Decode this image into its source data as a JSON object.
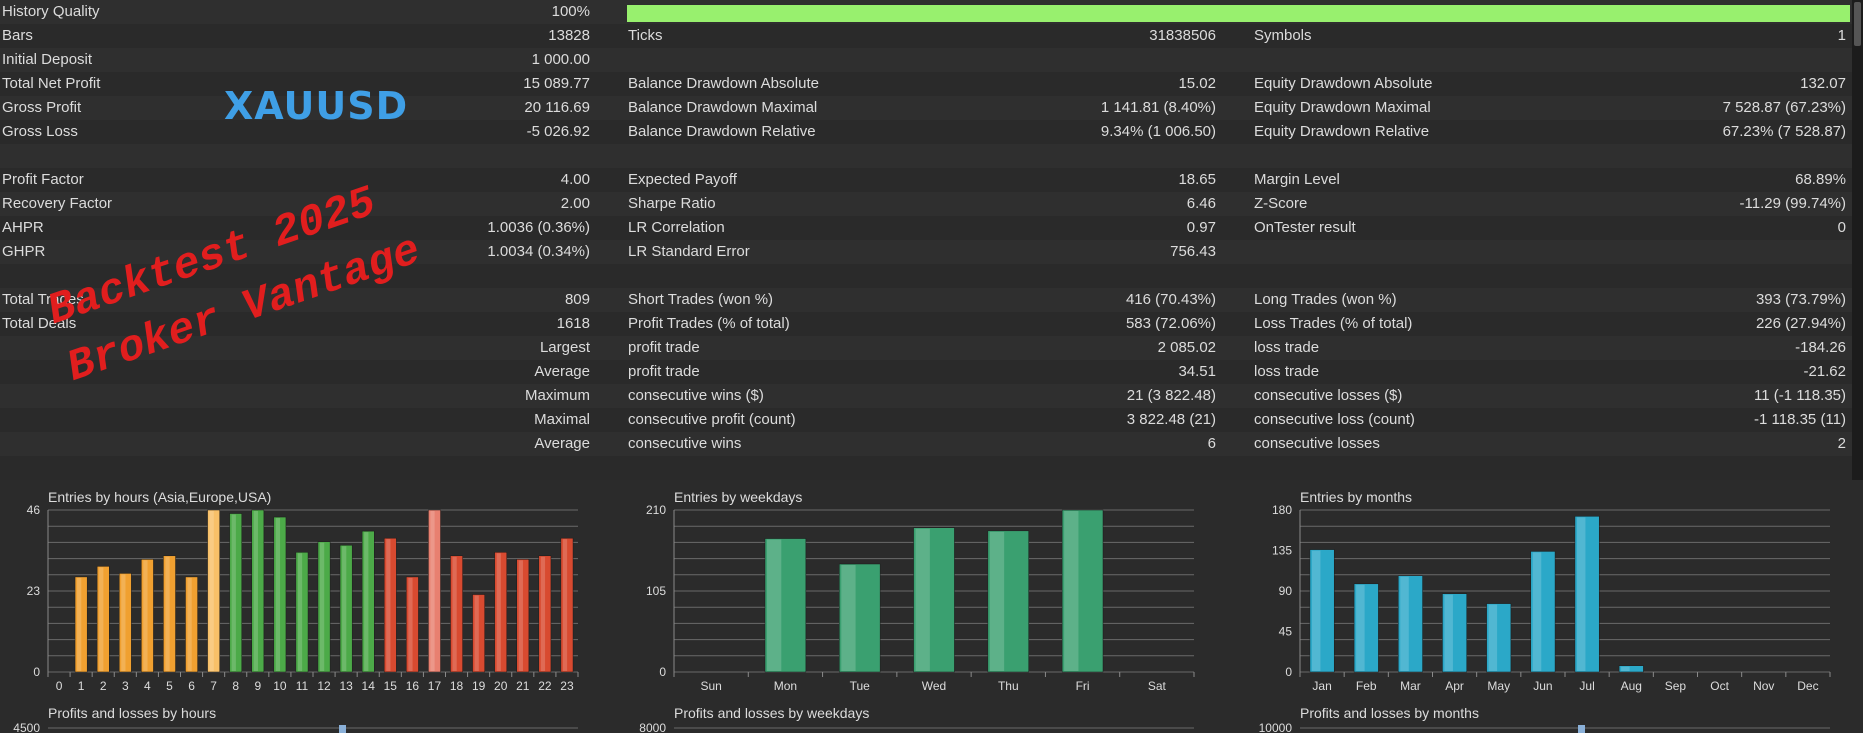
{
  "rows": [
    {
      "l1": "History Quality",
      "v1": "100%",
      "l2": "",
      "v2": "",
      "l3": "",
      "v3": ""
    },
    {
      "l1": "Bars",
      "v1": "13828",
      "l2": "Ticks",
      "v2": "31838506",
      "l3": "Symbols",
      "v3": "1"
    },
    {
      "l1": "Initial Deposit",
      "v1": "1 000.00",
      "l2": "",
      "v2": "",
      "l3": "",
      "v3": ""
    },
    {
      "l1": "Total Net Profit",
      "v1": "15 089.77",
      "l2": "Balance Drawdown Absolute",
      "v2": "15.02",
      "l3": "Equity Drawdown Absolute",
      "v3": "132.07"
    },
    {
      "l1": "Gross Profit",
      "v1": "20 116.69",
      "l2": "Balance Drawdown Maximal",
      "v2": "1 141.81 (8.40%)",
      "l3": "Equity Drawdown Maximal",
      "v3": "7 528.87 (67.23%)"
    },
    {
      "l1": "Gross Loss",
      "v1": "-5 026.92",
      "l2": "Balance Drawdown Relative",
      "v2": "9.34% (1 006.50)",
      "l3": "Equity Drawdown Relative",
      "v3": "67.23% (7 528.87)"
    },
    {
      "l1": "",
      "v1": "",
      "l2": "",
      "v2": "",
      "l3": "",
      "v3": ""
    },
    {
      "l1": "Profit Factor",
      "v1": "4.00",
      "l2": "Expected Payoff",
      "v2": "18.65",
      "l3": "Margin Level",
      "v3": "68.89%"
    },
    {
      "l1": "Recovery Factor",
      "v1": "2.00",
      "l2": "Sharpe Ratio",
      "v2": "6.46",
      "l3": "Z-Score",
      "v3": "-11.29 (99.74%)"
    },
    {
      "l1": "AHPR",
      "v1": "1.0036 (0.36%)",
      "l2": "LR Correlation",
      "v2": "0.97",
      "l3": "OnTester result",
      "v3": "0"
    },
    {
      "l1": "GHPR",
      "v1": "1.0034 (0.34%)",
      "l2": "LR Standard Error",
      "v2": "756.43",
      "l3": "",
      "v3": ""
    },
    {
      "l1": "",
      "v1": "",
      "l2": "",
      "v2": "",
      "l3": "",
      "v3": ""
    },
    {
      "l1": "Total Trades",
      "v1": "809",
      "l2": "Short Trades (won %)",
      "v2": "416 (70.43%)",
      "l3": "Long Trades (won %)",
      "v3": "393 (73.79%)"
    },
    {
      "l1": "Total Deals",
      "v1": "1618",
      "l2": "Profit Trades (% of total)",
      "v2": "583 (72.06%)",
      "l3": "Loss Trades (% of total)",
      "v3": "226 (27.94%)"
    },
    {
      "l1": "",
      "v1": "Largest",
      "l2": "profit trade",
      "v2": "2 085.02",
      "l3": "loss trade",
      "v3": "-184.26"
    },
    {
      "l1": "",
      "v1": "Average",
      "l2": "profit trade",
      "v2": "34.51",
      "l3": "loss trade",
      "v3": "-21.62"
    },
    {
      "l1": "",
      "v1": "Maximum",
      "l2": "consecutive wins ($)",
      "v2": "21 (3 822.48)",
      "l3": "consecutive losses ($)",
      "v3": "11 (-1 118.35)"
    },
    {
      "l1": "",
      "v1": "Maximal",
      "l2": "consecutive profit (count)",
      "v2": "3 822.48 (21)",
      "l3": "consecutive loss (count)",
      "v3": "-1 118.35 (11)"
    },
    {
      "l1": "",
      "v1": "Average",
      "l2": "consecutive wins",
      "v2": "6",
      "l3": "consecutive losses",
      "v3": "2"
    },
    {
      "l1": "",
      "v1": "",
      "l2": "",
      "v2": "",
      "l3": "",
      "v3": ""
    }
  ],
  "history_quality_fill": 1.0,
  "overlay": {
    "symbol": "XAUUSD",
    "stamp_line1": "Backtest 2025",
    "stamp_line2": "Broker Vantage"
  },
  "chart_data": [
    {
      "type": "bar",
      "title": "Entries by hours (Asia,Europe,USA)",
      "categories": [
        "0",
        "1",
        "2",
        "3",
        "4",
        "5",
        "6",
        "7",
        "8",
        "9",
        "10",
        "11",
        "12",
        "13",
        "14",
        "15",
        "16",
        "17",
        "18",
        "19",
        "20",
        "21",
        "22",
        "23"
      ],
      "values": [
        0,
        27,
        30,
        28,
        32,
        33,
        27,
        46,
        45,
        46,
        44,
        34,
        37,
        36,
        40,
        38,
        27,
        46,
        33,
        22,
        34,
        32,
        33,
        38
      ],
      "ylim": [
        0,
        46
      ],
      "yticks": [
        "0",
        "23",
        "46"
      ],
      "bar_colors": [
        "#f0a030",
        "#f0a030",
        "#f0a030",
        "#f0a030",
        "#f0a030",
        "#f0a030",
        "#f0a030",
        "#f8c068",
        "#4caa48",
        "#4caa48",
        "#4caa48",
        "#4caa48",
        "#4caa48",
        "#4caa48",
        "#4caa48",
        "#d84a30",
        "#d84a30",
        "#e88070",
        "#d84a30",
        "#d84a30",
        "#d84a30",
        "#d84a30",
        "#d84a30",
        "#d84a30"
      ]
    },
    {
      "type": "bar",
      "title": "Entries by weekdays",
      "categories": [
        "Sun",
        "Mon",
        "Tue",
        "Wed",
        "Thu",
        "Fri",
        "Sat"
      ],
      "values": [
        0,
        173,
        140,
        187,
        183,
        225,
        0
      ],
      "ylim": [
        0,
        210
      ],
      "yticks": [
        "0",
        "105",
        "210"
      ],
      "bar_color": "#3aa070"
    },
    {
      "type": "bar",
      "title": "Entries by months",
      "categories": [
        "Jan",
        "Feb",
        "Mar",
        "Apr",
        "May",
        "Jun",
        "Jul",
        "Aug",
        "Sep",
        "Oct",
        "Nov",
        "Dec"
      ],
      "values": [
        136,
        98,
        107,
        87,
        76,
        134,
        173,
        7,
        0,
        0,
        0,
        0
      ],
      "ylim": [
        0,
        180
      ],
      "yticks": [
        "0",
        "45",
        "90",
        "135",
        "180"
      ],
      "bar_color": "#2ba8c8"
    },
    {
      "type": "bar",
      "title": "Profits and losses by hours",
      "yticks": [
        "4500"
      ]
    },
    {
      "type": "bar",
      "title": "Profits and losses by weekdays",
      "yticks": [
        "8000"
      ]
    },
    {
      "type": "bar",
      "title": "Profits and losses by months",
      "yticks": [
        "10000"
      ]
    }
  ]
}
